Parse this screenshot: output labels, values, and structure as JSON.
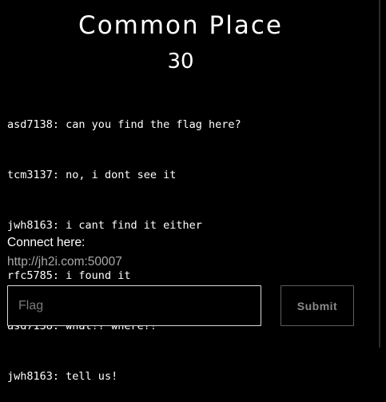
{
  "challenge": {
    "title": "Common Place",
    "points": "30"
  },
  "chat": [
    {
      "user": "asd7138",
      "message": "can you find the flag here?"
    },
    {
      "user": "tcm3137",
      "message": "no, i dont see it"
    },
    {
      "user": "jwh8163",
      "message": "i cant find it either"
    },
    {
      "user": "rfc5785",
      "message": "i found it"
    },
    {
      "user": "asd7138",
      "message": "what!? where?!"
    },
    {
      "user": "jwh8163",
      "message": "tell us!"
    }
  ],
  "connect": {
    "label": "Connect here:",
    "url": "http://jh2i.com:50007"
  },
  "form": {
    "flag_placeholder": "Flag",
    "flag_value": "",
    "submit_label": "Submit"
  },
  "colors": {
    "background": "#000000",
    "text": "#ffffff",
    "link": "#a9a9a9",
    "input_border": "#d9d9d9",
    "button_border": "#5f5f5f",
    "button_text": "#8a8a8a"
  }
}
